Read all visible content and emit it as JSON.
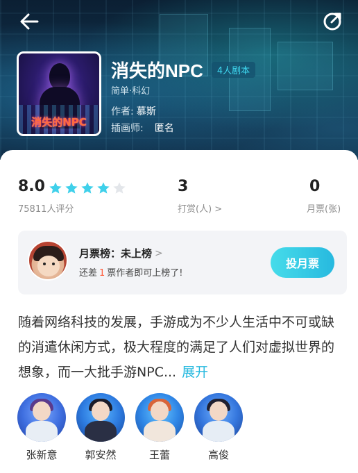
{
  "header": {
    "back_icon": "arrow-left-icon",
    "share_icon": "share-icon"
  },
  "cover": {
    "title_text": "消失的NPC"
  },
  "script": {
    "title": "消失的NPC",
    "players_tag": "4人剧本",
    "genre": "简单·科幻",
    "author_label": "作者:",
    "author": "慕斯",
    "illustrator_label": "插画师:",
    "illustrator": "匿名"
  },
  "stats": {
    "rating": "8.0",
    "stars_filled": 4,
    "stars_total": 5,
    "rating_count": "75811人评分",
    "tips": "3",
    "tips_label": "打赏(人) >",
    "monthly_tickets": "0",
    "monthly_tickets_label": "月票(张)"
  },
  "monthly": {
    "title": "月票榜：未上榜",
    "chevron": ">",
    "sub_prefix": "还差",
    "sub_num": "1",
    "sub_suffix": "票作者即可上榜了!",
    "vote_button": "投月票"
  },
  "description": {
    "text": "随着网络科技的发展，手游成为不少人生活中不可或缺的消遣休闲方式，极大程度的满足了人们对虚拟世界的想象，而一大批手游NPC...",
    "expand": "展开"
  },
  "roles": [
    {
      "name": "张新意"
    },
    {
      "name": "郭安然"
    },
    {
      "name": "王蕾"
    },
    {
      "name": "高俊"
    }
  ],
  "colors": {
    "accent": "#27b9df",
    "star": "#3fd0ea",
    "highlight_num": "#ff5b3a"
  }
}
